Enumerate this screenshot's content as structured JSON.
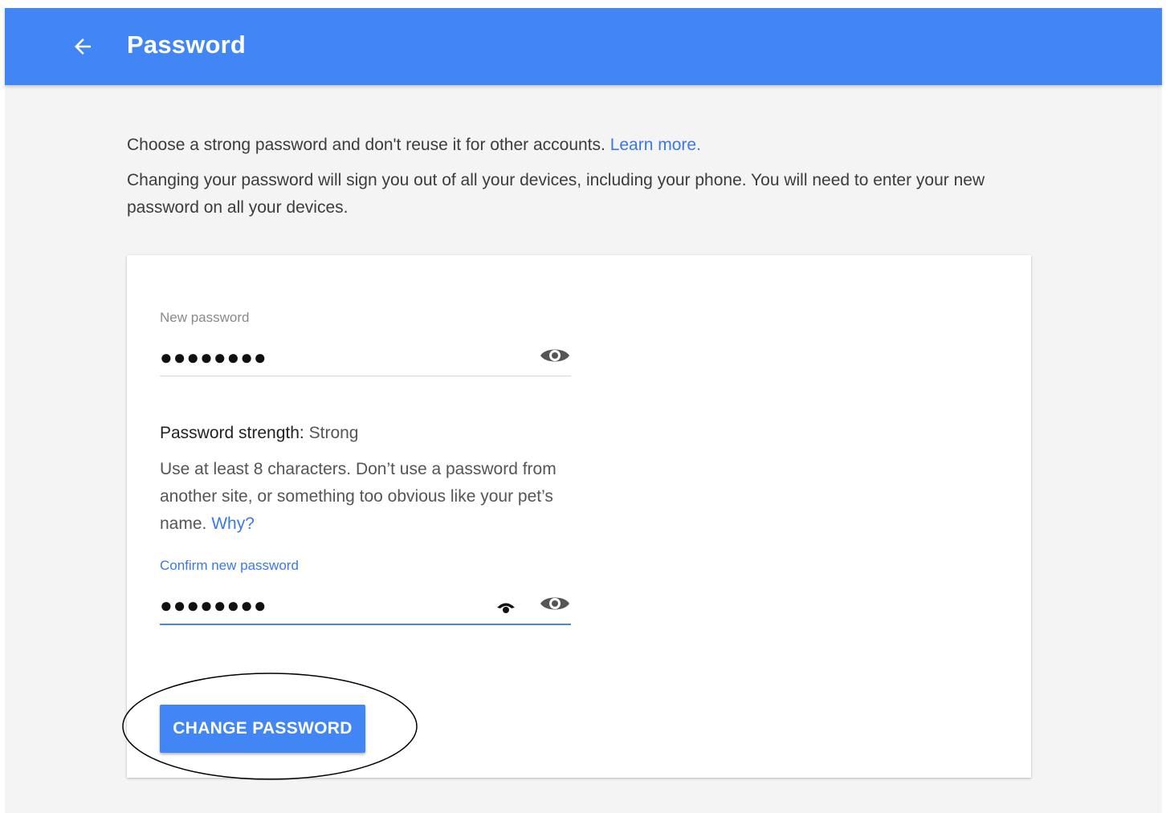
{
  "header": {
    "title": "Password",
    "back_icon": "arrow-back-icon",
    "background_color": "#4285f4"
  },
  "intro": {
    "line1": "Choose a strong password and don't reuse it for other accounts.",
    "learn_more": "Learn more.",
    "line2": "Changing your password will sign you out of all your devices, including your phone. You will need to enter your new password on all your devices."
  },
  "form": {
    "new_password": {
      "label": "New password",
      "value": "●●●●●●●●",
      "toggle_icon": "eye-icon"
    },
    "strength": {
      "label": "Password strength:",
      "value": "Strong"
    },
    "hint": {
      "text": "Use at least 8 characters. Don’t use a password from another site, or something too obvious like your pet’s name.",
      "why_link": "Why?"
    },
    "confirm_password": {
      "label": "Confirm new password",
      "value": "●●●●●●●●",
      "key_icon": "password-manager-key-icon",
      "toggle_icon": "eye-icon"
    },
    "submit_label": "CHANGE PASSWORD"
  },
  "colors": {
    "accent": "#4285f4",
    "link": "#3b78e7",
    "page_background": "#f4f4f4"
  }
}
